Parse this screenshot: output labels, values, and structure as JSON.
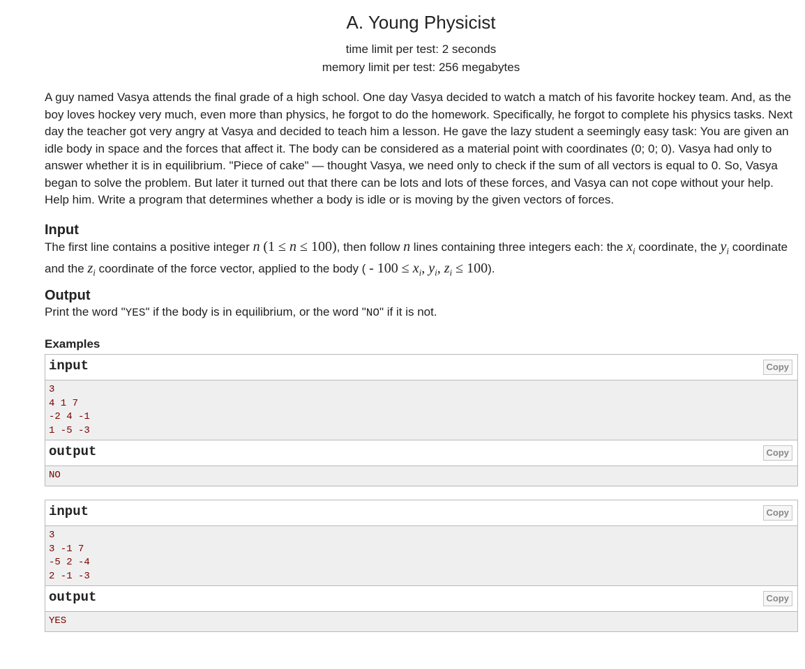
{
  "problem": {
    "title": "A. Young Physicist",
    "time_limit": "time limit per test: 2 seconds",
    "memory_limit": "memory limit per test: 256 megabytes"
  },
  "statement": "A guy named Vasya attends the final grade of a high school. One day Vasya decided to watch a match of his favorite hockey team. And, as the boy loves hockey very much, even more than physics, he forgot to do the homework. Specifically, he forgot to complete his physics tasks. Next day the teacher got very angry at Vasya and decided to teach him a lesson. He gave the lazy student a seemingly easy task: You are given an idle body in space and the forces that affect it. The body can be considered as a material point with coordinates (0; 0; 0). Vasya had only to answer whether it is in equilibrium. \"Piece of cake\" — thought Vasya, we need only to check if the sum of all vectors is equal to 0. So, Vasya began to solve the problem. But later it turned out that there can be lots and lots of these forces, and Vasya can not cope without your help. Help him. Write a program that determines whether a body is idle or is moving by the given vectors of forces.",
  "input_section": {
    "title": "Input",
    "t1": "The first line contains a positive integer ",
    "m1": "n",
    "m2": "(1 ≤ ",
    "m3": "n",
    "m4": " ≤ 100)",
    "t2": ", then follow ",
    "m5": "n",
    "t3": " lines containing three integers each: the ",
    "m6": "x",
    "s6": "i",
    "t4": " coordinate, the ",
    "m7": "y",
    "s7": "i",
    "t5": " coordinate and the ",
    "m8": "z",
    "s8": "i",
    "t6": " coordinate of the force vector, applied to the body ( ",
    "m9": "- 100 ≤ ",
    "m10": "x",
    "s10": "i",
    "m11": ", ",
    "m12": "y",
    "s12": "i",
    "m13": ", ",
    "m14": "z",
    "s14": "i",
    "m15": " ≤ 100",
    "t7": ")."
  },
  "output_section": {
    "title": "Output",
    "t1": "Print the word \"",
    "yes": "YES",
    "t2": "\" if the body is in equilibrium, or the word \"",
    "no": "NO",
    "t3": "\" if it is not."
  },
  "examples": {
    "title": "Examples",
    "input_label": "input",
    "output_label": "output",
    "copy_label": "Copy",
    "items": [
      {
        "input": "3\n4 1 7\n-2 4 -1\n1 -5 -3",
        "output": "NO"
      },
      {
        "input": "3\n3 -1 7\n-5 2 -4\n2 -1 -3",
        "output": "YES"
      }
    ]
  }
}
